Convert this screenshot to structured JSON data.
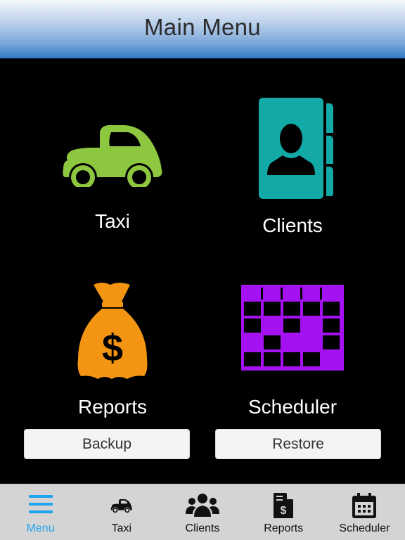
{
  "header": {
    "title": "Main Menu"
  },
  "tiles": [
    {
      "id": "taxi",
      "label": "Taxi",
      "icon": "car-icon",
      "color": "#8dc63f"
    },
    {
      "id": "clients",
      "label": "Clients",
      "icon": "address-book-icon",
      "color": "#13a9a6"
    },
    {
      "id": "reports",
      "label": "Reports",
      "icon": "money-bag-icon",
      "color": "#f39412"
    },
    {
      "id": "scheduler",
      "label": "Scheduler",
      "icon": "calendar-grid-icon",
      "color": "#a412f2"
    }
  ],
  "buttons": {
    "backup": "Backup",
    "restore": "Restore"
  },
  "tabbar": {
    "active": "menu",
    "active_color": "#1ea3ef",
    "tabs": [
      {
        "id": "menu",
        "label": "Menu",
        "icon": "hamburger-menu-icon"
      },
      {
        "id": "taxi",
        "label": "Taxi",
        "icon": "car-icon"
      },
      {
        "id": "clients",
        "label": "Clients",
        "icon": "users-group-icon"
      },
      {
        "id": "reports",
        "label": "Reports",
        "icon": "invoice-dollar-icon"
      },
      {
        "id": "scheduler",
        "label": "Scheduler",
        "icon": "calendar-icon"
      }
    ]
  }
}
